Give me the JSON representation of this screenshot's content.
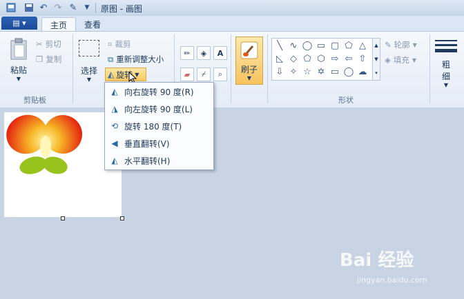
{
  "window": {
    "title": "原图 - 画图"
  },
  "file_menu": {
    "label": "▤ ▾"
  },
  "tabs": [
    {
      "label": "主页"
    },
    {
      "label": "查看"
    }
  ],
  "clipboard": {
    "paste": "粘贴",
    "cut": "剪切",
    "copy": "复制",
    "group": "剪贴板"
  },
  "image": {
    "select": "选择",
    "crop": "裁剪",
    "resize": "重新调整大小",
    "rotate": "旋转"
  },
  "brush": {
    "label": "刷子"
  },
  "shapes": {
    "group": "形状",
    "outline": "轮廓",
    "fill": "填充"
  },
  "size": {
    "label_line1": "粗",
    "label_line2": "细"
  },
  "rotate_menu": {
    "items": [
      {
        "label": "向右旋转 90 度(R)",
        "icon": "rotate-right-icon"
      },
      {
        "label": "向左旋转 90 度(L)",
        "icon": "rotate-left-icon"
      },
      {
        "label": "旋转 180 度(T)",
        "icon": "rotate-180-icon"
      },
      {
        "label": "垂直翻转(V)",
        "icon": "flip-vertical-icon"
      },
      {
        "label": "水平翻转(H)",
        "icon": "flip-horizontal-icon"
      }
    ]
  },
  "watermark": {
    "main": "Bai 经验",
    "sub": "jingyan.baidu.com"
  },
  "colors": {
    "accent": "#f8c863",
    "file_button": "#1b4a98"
  }
}
